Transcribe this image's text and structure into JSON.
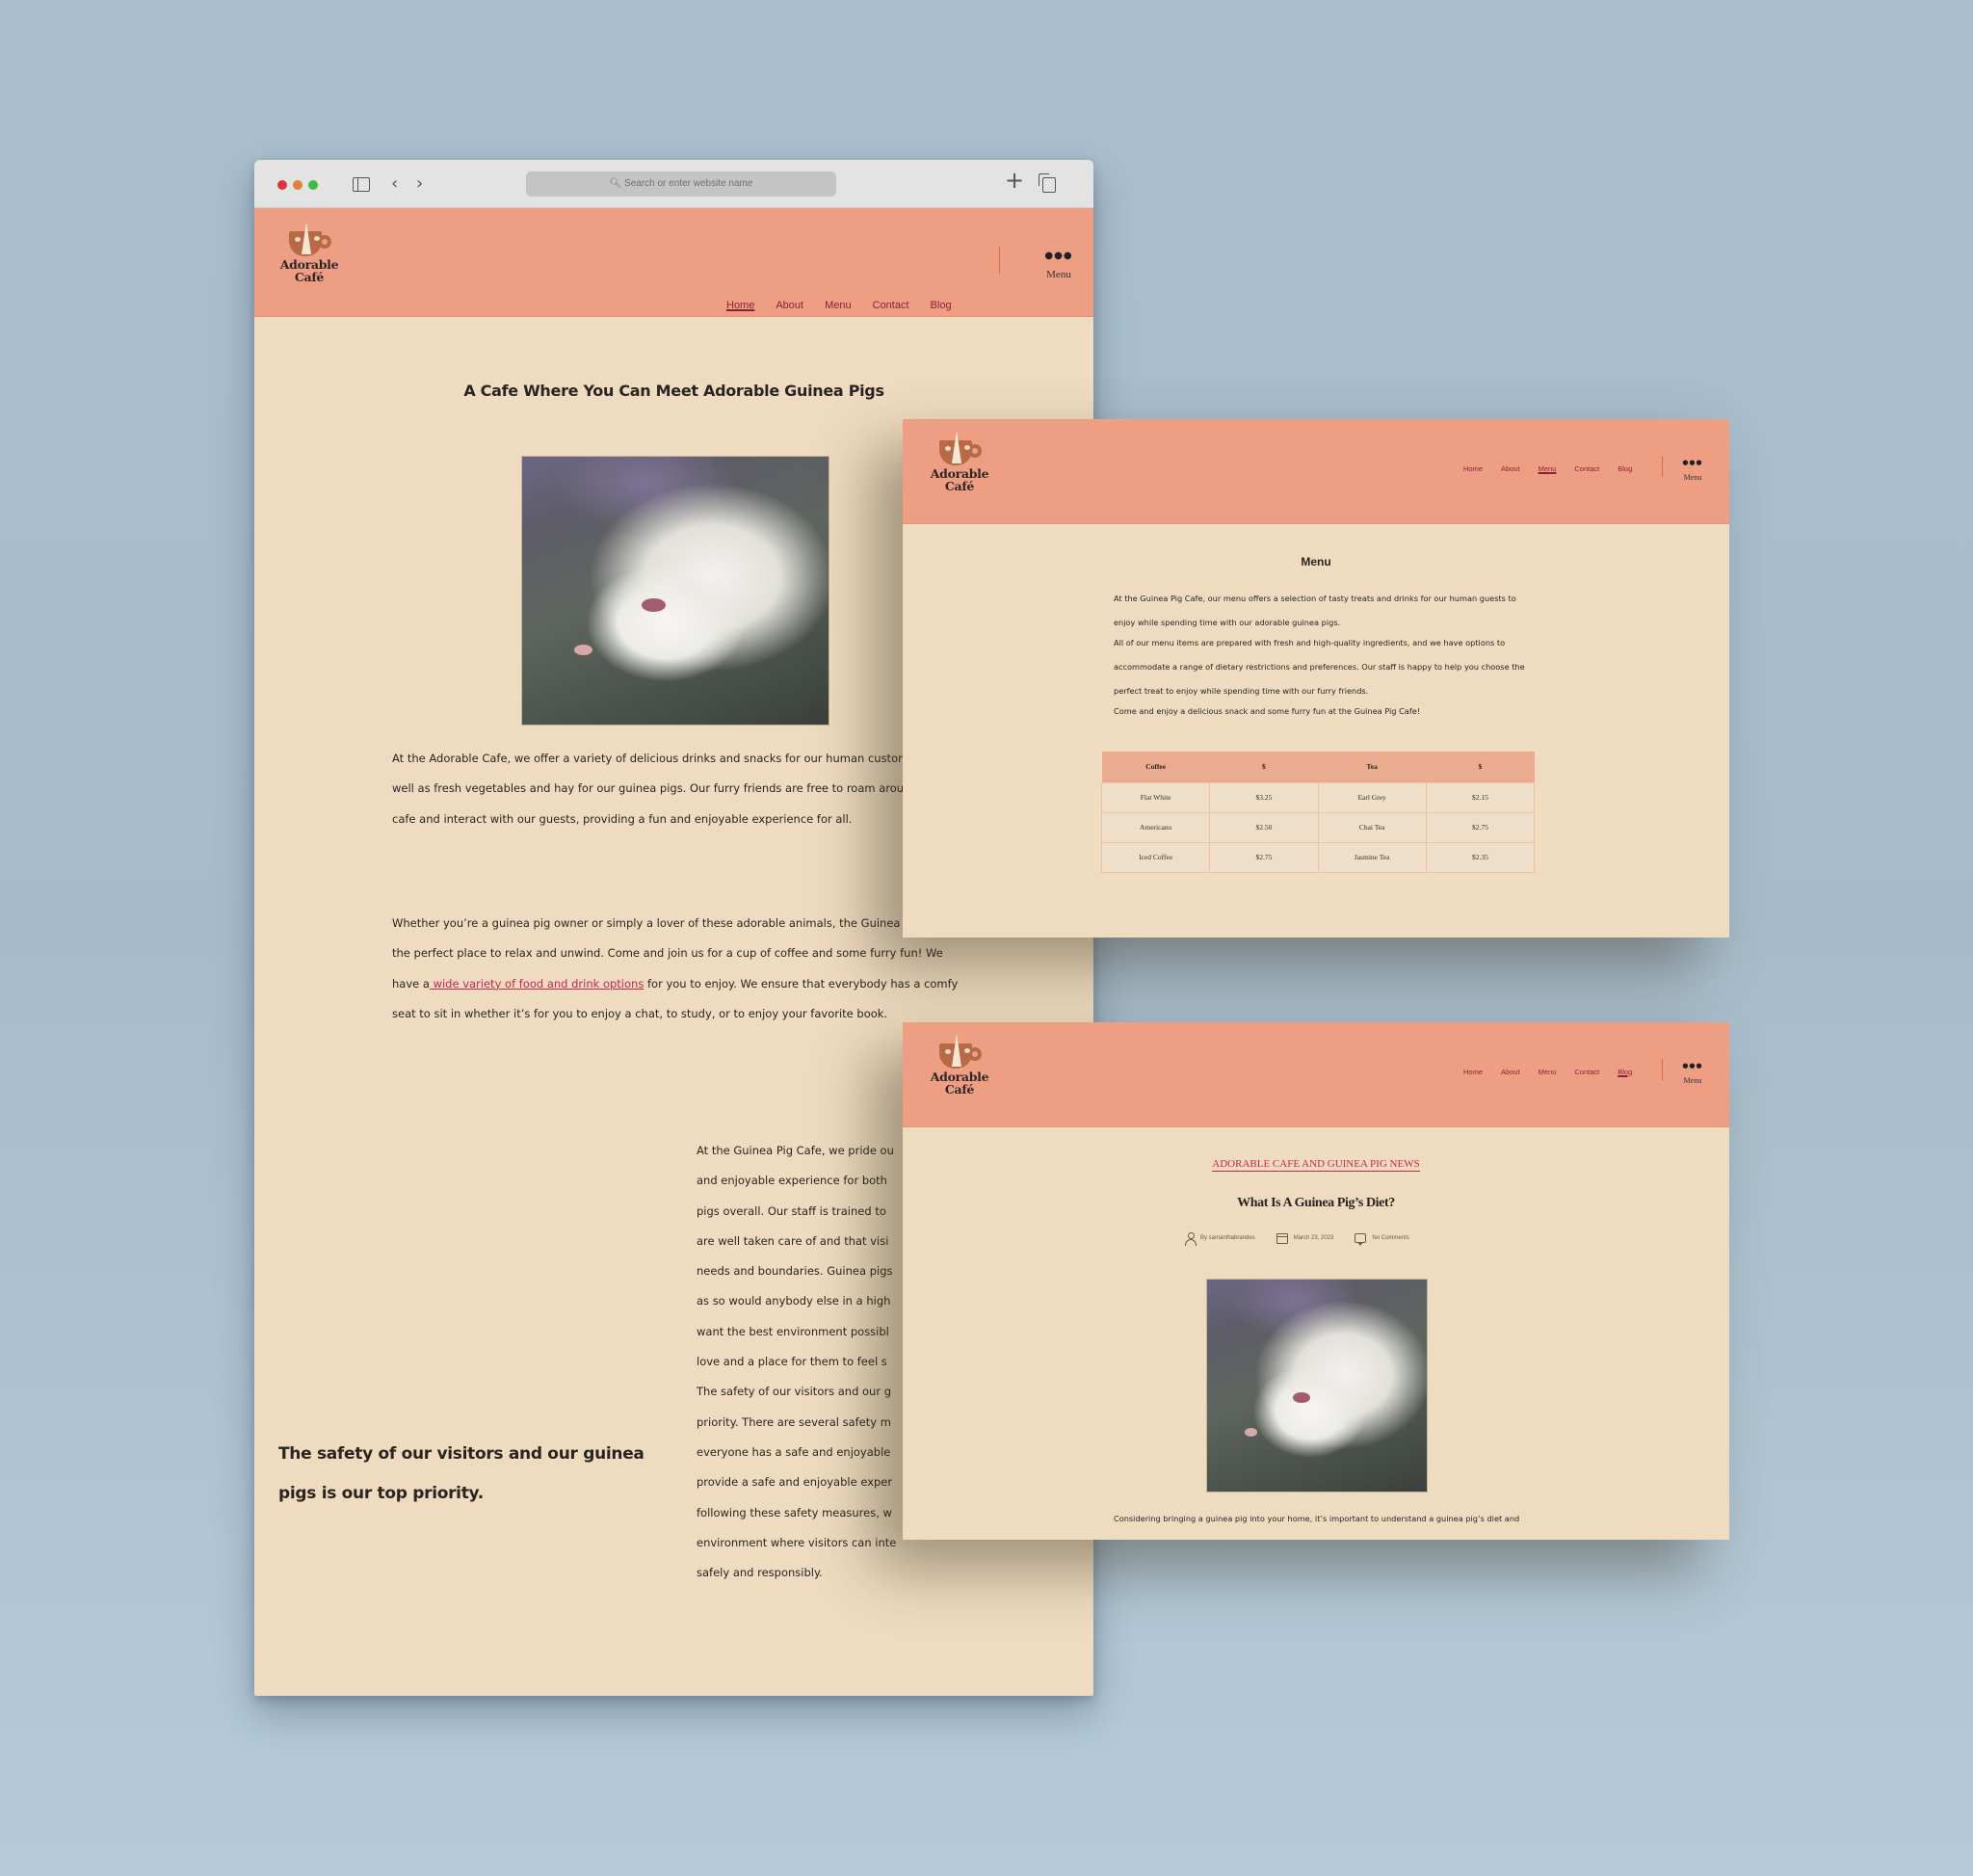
{
  "browser": {
    "address_placeholder": "Search or enter website name",
    "icons": {
      "close": "red-dot",
      "minimize": "orange-dot",
      "maximize": "green-dot",
      "sidebar": "sidebar-icon",
      "back": "‹",
      "forward": "›",
      "new_tab": "+",
      "tabs": "tabs-overview-icon"
    }
  },
  "site": {
    "logo_line1": "Adorable",
    "logo_line2": "Café",
    "nav": [
      "Home",
      "About",
      "Menu",
      "Contact",
      "Blog"
    ],
    "more_dots": "●●●",
    "more_label": "Menu",
    "colors": {
      "header": "#ee9e83",
      "page": "#efdcc0",
      "nav_text": "#8e1f3b",
      "link": "#c5264f",
      "table_header": "#eaab8f"
    }
  },
  "home": {
    "active_nav": "Home",
    "title": "A Cafe Where You Can Meet Adorable Guinea Pigs",
    "image_alt": "White long-haired guinea pig resting on a blanket",
    "paragraph1": "At the Adorable Cafe, we offer a variety of delicious drinks and snacks for our human customers, as well as fresh vegetables and hay for our guinea pigs. Our furry friends are free to roam around the cafe and interact with our guests, providing a fun and enjoyable experience for all.",
    "paragraph2_before": "Whether you’re a guinea pig owner or simply a lover of these adorable animals, the Guinea Pig Cafe is the perfect place to relax and unwind. Come and join us for a cup of coffee and some furry fun! We have a",
    "paragraph2_link": " wide variety of food and drink options",
    "paragraph2_after": " for you to enjoy. We ensure that everybody has a comfy seat to sit in whether it’s for you to enjoy a chat, to study, or to enjoy your favorite book.",
    "pull_quote": "The safety of our visitors and our guinea pigs is our top priority.",
    "paragraph3_lines": [
      "At the Guinea Pig Cafe, we pride ou",
      "and enjoyable experience for both",
      "pigs overall. Our staff is trained to",
      "are well taken care of and that visi",
      "needs and boundaries. Guinea pigs",
      "as so would anybody else in a high",
      "want the best environment possibl",
      "love and a place for them to feel s",
      "The safety of our visitors and our g",
      "priority. There are several safety m",
      "everyone has a safe and enjoyable",
      "provide a safe and enjoyable exper",
      "following these safety measures, w",
      "environment where visitors can inte",
      "safely and responsibly."
    ]
  },
  "menu_page": {
    "active_nav": "Menu",
    "title": "Menu",
    "paragraph1": "At the Guinea Pig Cafe, our menu offers a selection of tasty treats and drinks for our human guests to enjoy while spending time with our adorable guinea pigs.",
    "paragraph2": "All of our menu items are prepared with fresh and high-quality ingredients, and we have options to accommodate a range of dietary restrictions and preferences. Our staff is happy to help you choose the perfect treat to enjoy while spending time with our furry friends.",
    "paragraph3": "Come and enjoy a delicious snack and some furry fun at the Guinea Pig Cafe!",
    "table": {
      "headers": [
        "Coffee",
        "$",
        "Tea",
        "$"
      ],
      "rows": [
        [
          "Flat White",
          "$3.25",
          "Earl Grey",
          "$2.15"
        ],
        [
          "Americano",
          "$2.50",
          "Chai Tea",
          "$2.75"
        ],
        [
          "Iced Coffee",
          "$2.75",
          "Jasmine Tea",
          "$2.35"
        ]
      ]
    }
  },
  "blog_page": {
    "active_nav": "Blog",
    "category": "ADORABLE CAFE AND GUINEA PIG NEWS",
    "post_title": "What Is A Guinea Pig’s Diet?",
    "author": "By samanthabrandes",
    "date": "March 23, 2023",
    "comments": "No Comments",
    "image_alt": "White long-haired guinea pig resting on a blanket",
    "excerpt": "Considering bringing a guinea pig into your home, it’s important to understand a guinea pig’s diet and how to properly care for them with the right nutrition and variety of foods and treats."
  }
}
